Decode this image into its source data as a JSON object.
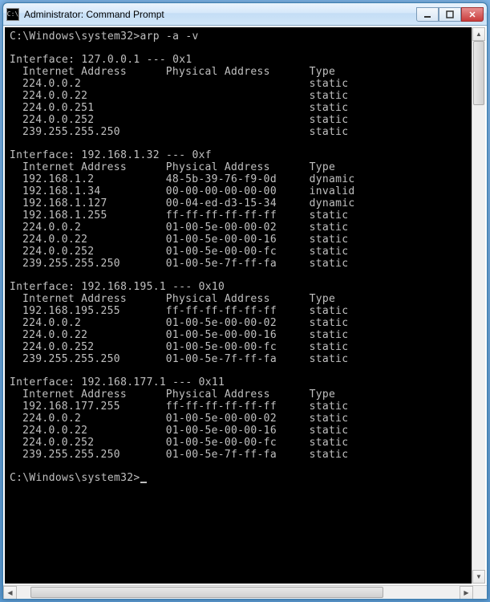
{
  "window": {
    "title": "Administrator: Command Prompt"
  },
  "prompt_path": "C:\\Windows\\system32>",
  "command": "arp -a -v",
  "headers": {
    "ip": "Internet Address",
    "mac": "Physical Address",
    "type": "Type"
  },
  "interfaces": [
    {
      "header": "Interface: 127.0.0.1 --- 0x1",
      "rows": [
        {
          "ip": "224.0.0.2",
          "mac": "",
          "type": "static"
        },
        {
          "ip": "224.0.0.22",
          "mac": "",
          "type": "static"
        },
        {
          "ip": "224.0.0.251",
          "mac": "",
          "type": "static"
        },
        {
          "ip": "224.0.0.252",
          "mac": "",
          "type": "static"
        },
        {
          "ip": "239.255.255.250",
          "mac": "",
          "type": "static"
        }
      ]
    },
    {
      "header": "Interface: 192.168.1.32 --- 0xf",
      "rows": [
        {
          "ip": "192.168.1.2",
          "mac": "48-5b-39-76-f9-0d",
          "type": "dynamic"
        },
        {
          "ip": "192.168.1.34",
          "mac": "00-00-00-00-00-00",
          "type": "invalid"
        },
        {
          "ip": "192.168.1.127",
          "mac": "00-04-ed-d3-15-34",
          "type": "dynamic"
        },
        {
          "ip": "192.168.1.255",
          "mac": "ff-ff-ff-ff-ff-ff",
          "type": "static"
        },
        {
          "ip": "224.0.0.2",
          "mac": "01-00-5e-00-00-02",
          "type": "static"
        },
        {
          "ip": "224.0.0.22",
          "mac": "01-00-5e-00-00-16",
          "type": "static"
        },
        {
          "ip": "224.0.0.252",
          "mac": "01-00-5e-00-00-fc",
          "type": "static"
        },
        {
          "ip": "239.255.255.250",
          "mac": "01-00-5e-7f-ff-fa",
          "type": "static"
        }
      ]
    },
    {
      "header": "Interface: 192.168.195.1 --- 0x10",
      "rows": [
        {
          "ip": "192.168.195.255",
          "mac": "ff-ff-ff-ff-ff-ff",
          "type": "static"
        },
        {
          "ip": "224.0.0.2",
          "mac": "01-00-5e-00-00-02",
          "type": "static"
        },
        {
          "ip": "224.0.0.22",
          "mac": "01-00-5e-00-00-16",
          "type": "static"
        },
        {
          "ip": "224.0.0.252",
          "mac": "01-00-5e-00-00-fc",
          "type": "static"
        },
        {
          "ip": "239.255.255.250",
          "mac": "01-00-5e-7f-ff-fa",
          "type": "static"
        }
      ]
    },
    {
      "header": "Interface: 192.168.177.1 --- 0x11",
      "rows": [
        {
          "ip": "192.168.177.255",
          "mac": "ff-ff-ff-ff-ff-ff",
          "type": "static"
        },
        {
          "ip": "224.0.0.2",
          "mac": "01-00-5e-00-00-02",
          "type": "static"
        },
        {
          "ip": "224.0.0.22",
          "mac": "01-00-5e-00-00-16",
          "type": "static"
        },
        {
          "ip": "224.0.0.252",
          "mac": "01-00-5e-00-00-fc",
          "type": "static"
        },
        {
          "ip": "239.255.255.250",
          "mac": "01-00-5e-7f-ff-fa",
          "type": "static"
        }
      ]
    }
  ]
}
